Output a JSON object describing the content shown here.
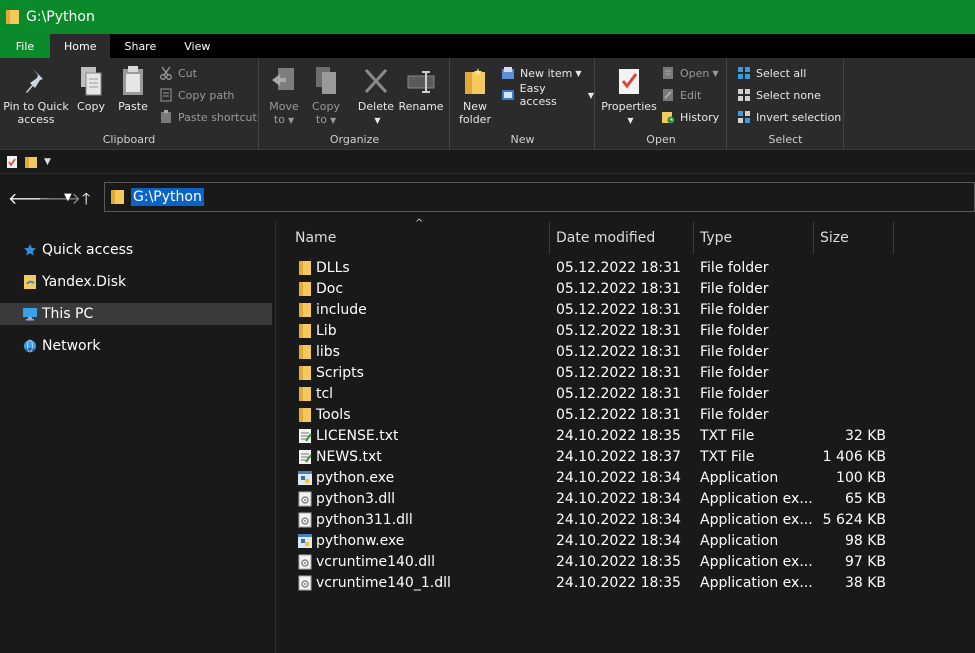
{
  "window": {
    "title": "G:\\Python"
  },
  "menu": {
    "file": "File",
    "home": "Home",
    "share": "Share",
    "view": "View"
  },
  "ribbon": {
    "clipboard": {
      "label": "Clipboard",
      "pin_line1": "Pin to Quick",
      "pin_line2": "access",
      "copy": "Copy",
      "paste": "Paste",
      "cut": "Cut",
      "copy_path": "Copy path",
      "paste_shortcut": "Paste shortcut"
    },
    "organize": {
      "label": "Organize",
      "move_line1": "Move",
      "move_line2": "to",
      "copy_line1": "Copy",
      "copy_line2": "to",
      "delete": "Delete",
      "rename": "Rename"
    },
    "new": {
      "label": "New",
      "folder_line1": "New",
      "folder_line2": "folder",
      "new_item": "New item",
      "easy_access": "Easy access"
    },
    "open": {
      "label": "Open",
      "properties": "Properties",
      "open": "Open",
      "edit": "Edit",
      "history": "History"
    },
    "select": {
      "label": "Select",
      "select_all": "Select all",
      "select_none": "Select none",
      "invert": "Invert selection"
    }
  },
  "address": {
    "path": "G:\\Python"
  },
  "nav": {
    "items": [
      {
        "label": "Quick access",
        "icon": "star-icon"
      },
      {
        "label": "Yandex.Disk",
        "icon": "yandex-disk-icon"
      },
      {
        "label": "This PC",
        "icon": "computer-icon"
      },
      {
        "label": "Network",
        "icon": "network-icon"
      }
    ]
  },
  "columns": {
    "name": "Name",
    "date": "Date modified",
    "type": "Type",
    "size": "Size"
  },
  "files": [
    {
      "name": "DLLs",
      "date": "05.12.2022 18:31",
      "type": "File folder",
      "size": "",
      "icon": "folder"
    },
    {
      "name": "Doc",
      "date": "05.12.2022 18:31",
      "type": "File folder",
      "size": "",
      "icon": "folder"
    },
    {
      "name": "include",
      "date": "05.12.2022 18:31",
      "type": "File folder",
      "size": "",
      "icon": "folder"
    },
    {
      "name": "Lib",
      "date": "05.12.2022 18:31",
      "type": "File folder",
      "size": "",
      "icon": "folder"
    },
    {
      "name": "libs",
      "date": "05.12.2022 18:31",
      "type": "File folder",
      "size": "",
      "icon": "folder"
    },
    {
      "name": "Scripts",
      "date": "05.12.2022 18:31",
      "type": "File folder",
      "size": "",
      "icon": "folder"
    },
    {
      "name": "tcl",
      "date": "05.12.2022 18:31",
      "type": "File folder",
      "size": "",
      "icon": "folder"
    },
    {
      "name": "Tools",
      "date": "05.12.2022 18:31",
      "type": "File folder",
      "size": "",
      "icon": "folder"
    },
    {
      "name": "LICENSE.txt",
      "date": "24.10.2022 18:35",
      "type": "TXT File",
      "size": "32 KB",
      "icon": "txt"
    },
    {
      "name": "NEWS.txt",
      "date": "24.10.2022 18:37",
      "type": "TXT File",
      "size": "1 406 KB",
      "icon": "txt"
    },
    {
      "name": "python.exe",
      "date": "24.10.2022 18:34",
      "type": "Application",
      "size": "100 KB",
      "icon": "exe"
    },
    {
      "name": "python3.dll",
      "date": "24.10.2022 18:34",
      "type": "Application ex...",
      "size": "65 KB",
      "icon": "dll"
    },
    {
      "name": "python311.dll",
      "date": "24.10.2022 18:34",
      "type": "Application ex...",
      "size": "5 624 KB",
      "icon": "dll"
    },
    {
      "name": "pythonw.exe",
      "date": "24.10.2022 18:34",
      "type": "Application",
      "size": "98 KB",
      "icon": "exe"
    },
    {
      "name": "vcruntime140.dll",
      "date": "24.10.2022 18:35",
      "type": "Application ex...",
      "size": "97 KB",
      "icon": "dll"
    },
    {
      "name": "vcruntime140_1.dll",
      "date": "24.10.2022 18:35",
      "type": "Application ex...",
      "size": "38 KB",
      "icon": "dll"
    }
  ]
}
